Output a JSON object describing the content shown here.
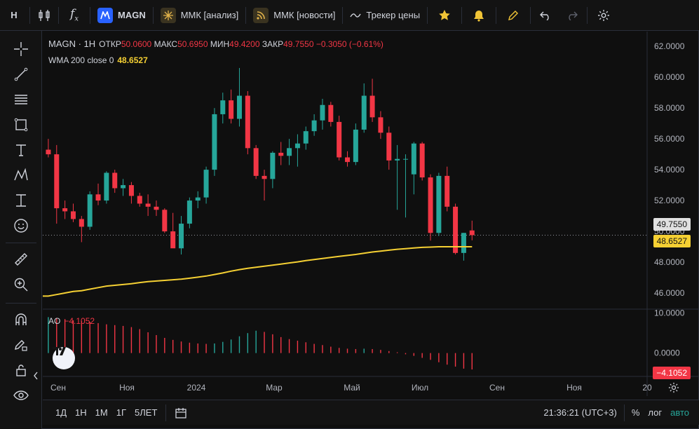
{
  "toolbar": {
    "interval": "Н",
    "symbol": "MAGN",
    "tab_analysis": "ММК [анализ]",
    "tab_news": "ММК [новости]",
    "tracker": "Трекер цены"
  },
  "legend": {
    "symbol": "MAGN · 1Н",
    "open_label": "ОТКР",
    "open": "50.0600",
    "high_label": "МАКС",
    "high": "50.6950",
    "low_label": "МИН",
    "low": "49.4200",
    "close_label": "ЗАКР",
    "close": "49.7550",
    "change": "−0.3050 (−0.61%)",
    "wma_label": "WMA 200 close 0",
    "wma_value": "48.6527",
    "ao_label": "AO",
    "ao_value": "−4.1052"
  },
  "price_tags": {
    "last": "49.7550",
    "wma": "48.6527",
    "ao": "−4.1052"
  },
  "bottombar": {
    "ranges": [
      "1Д",
      "1Н",
      "1М",
      "1Г",
      "5ЛЕТ"
    ],
    "time": "21:36:21 (UTC+3)",
    "percent": "%",
    "log": "лог",
    "auto": "авто"
  },
  "colors": {
    "up": "#26a69a",
    "down": "#f23645",
    "wma": "#f5d033",
    "background": "#0f0f0f"
  },
  "chart_data": {
    "type": "candlestick",
    "price_axis": {
      "ticks": [
        "62.0000",
        "60.0000",
        "58.0000",
        "56.0000",
        "54.0000",
        "52.0000",
        "50.0000",
        "48.0000",
        "46.0000"
      ],
      "range": [
        45.0,
        62.6
      ]
    },
    "time_axis": {
      "ticks": [
        "Сен",
        "Ноя",
        "2024",
        "Мар",
        "Май",
        "Июл",
        "Сен",
        "Ноя",
        "20"
      ]
    },
    "ao_axis": {
      "ticks": [
        "10.0000",
        "0.0000"
      ],
      "range": [
        -5.5,
        11.0
      ]
    },
    "candles": [
      [
        55.3,
        56.0,
        54.8,
        55.0
      ],
      [
        55.0,
        55.6,
        50.5,
        51.5
      ],
      [
        51.5,
        52.0,
        50.8,
        51.3
      ],
      [
        51.3,
        51.8,
        50.6,
        50.8
      ],
      [
        50.8,
        51.0,
        49.3,
        50.3
      ],
      [
        50.3,
        52.6,
        50.1,
        52.4
      ],
      [
        52.4,
        53.1,
        51.7,
        52.0
      ],
      [
        52.0,
        53.9,
        51.8,
        53.8
      ],
      [
        53.8,
        54.0,
        52.5,
        52.8
      ],
      [
        52.8,
        53.4,
        52.3,
        53.0
      ],
      [
        53.0,
        53.2,
        51.8,
        52.3
      ],
      [
        52.3,
        52.5,
        51.6,
        51.8
      ],
      [
        51.8,
        52.4,
        51.0,
        51.6
      ],
      [
        51.6,
        52.0,
        51.0,
        51.4
      ],
      [
        51.4,
        51.5,
        49.9,
        50.0
      ],
      [
        50.0,
        51.2,
        49.1,
        48.9
      ],
      [
        48.9,
        51.0,
        48.5,
        50.5
      ],
      [
        50.5,
        52.2,
        50.2,
        52.0
      ],
      [
        52.0,
        52.6,
        51.5,
        52.2
      ],
      [
        52.2,
        54.2,
        51.8,
        54.0
      ],
      [
        54.0,
        58.0,
        53.6,
        57.6
      ],
      [
        57.6,
        59.0,
        57.0,
        58.5
      ],
      [
        58.5,
        59.2,
        57.0,
        57.3
      ],
      [
        57.3,
        60.6,
        56.8,
        58.8
      ],
      [
        58.8,
        59.1,
        55.0,
        55.4
      ],
      [
        55.4,
        55.6,
        53.4,
        53.6
      ],
      [
        53.6,
        54.0,
        52.0,
        53.4
      ],
      [
        53.4,
        55.2,
        52.8,
        55.1
      ],
      [
        55.1,
        55.8,
        54.3,
        54.9
      ],
      [
        54.9,
        56.0,
        54.3,
        55.4
      ],
      [
        55.4,
        56.3,
        54.2,
        55.7
      ],
      [
        55.7,
        56.8,
        55.3,
        56.5
      ],
      [
        56.5,
        57.6,
        56.2,
        57.2
      ],
      [
        57.2,
        58.6,
        56.6,
        58.2
      ],
      [
        58.2,
        58.4,
        56.8,
        57.1
      ],
      [
        57.1,
        57.5,
        54.6,
        54.8
      ],
      [
        54.8,
        55.2,
        54.2,
        54.5
      ],
      [
        54.5,
        57.0,
        54.3,
        56.6
      ],
      [
        56.6,
        59.6,
        56.4,
        58.8
      ],
      [
        58.8,
        59.9,
        57.1,
        57.4
      ],
      [
        57.4,
        57.8,
        56.0,
        56.4
      ],
      [
        56.4,
        56.8,
        54.0,
        54.6
      ],
      [
        54.6,
        55.6,
        51.4,
        54.7
      ],
      [
        54.7,
        55.0,
        50.9,
        54.7
      ],
      [
        53.7,
        55.8,
        52.4,
        55.7
      ],
      [
        55.7,
        55.8,
        53.3,
        53.5
      ],
      [
        53.5,
        53.7,
        49.4,
        49.9
      ],
      [
        49.9,
        53.8,
        49.7,
        53.6
      ],
      [
        53.6,
        54.2,
        51.3,
        51.6
      ],
      [
        51.6,
        51.8,
        48.5,
        48.6
      ],
      [
        48.6,
        49.9,
        48.1,
        49.9
      ],
      [
        50.06,
        50.695,
        49.42,
        49.755
      ]
    ],
    "wma": [
      45.8,
      45.9,
      46.0,
      46.1,
      46.15,
      46.25,
      46.35,
      46.45,
      46.5,
      46.55,
      46.6,
      46.68,
      46.74,
      46.78,
      46.82,
      46.86,
      46.9,
      46.96,
      47.03,
      47.1,
      47.2,
      47.3,
      47.42,
      47.52,
      47.6,
      47.67,
      47.74,
      47.81,
      47.88,
      47.95,
      48.02,
      48.1,
      48.17,
      48.24,
      48.31,
      48.38,
      48.44,
      48.5,
      48.58,
      48.66,
      48.72,
      48.78,
      48.84,
      48.88,
      48.92,
      48.96,
      48.98,
      49.0,
      49.0,
      49.0,
      49.0,
      49.0
    ],
    "ao": [
      9.0,
      8.8,
      8.5,
      8.2,
      8.0,
      7.8,
      7.5,
      7.2,
      7.0,
      6.8,
      6.5,
      6.0,
      5.2,
      4.5,
      3.8,
      3.3,
      2.9,
      2.6,
      2.4,
      2.3,
      2.4,
      2.8,
      3.4,
      4.2,
      5.0,
      5.6,
      5.3,
      4.7,
      4.0,
      3.5,
      3.1,
      2.7,
      2.3,
      2.0,
      1.6,
      1.3,
      1.1,
      1.0,
      1.1,
      1.0,
      0.8,
      0.5,
      0.2,
      -0.3,
      -0.7,
      -1.2,
      -1.7,
      -2.3,
      -2.9,
      -3.4,
      -3.9,
      -4.1052
    ]
  }
}
